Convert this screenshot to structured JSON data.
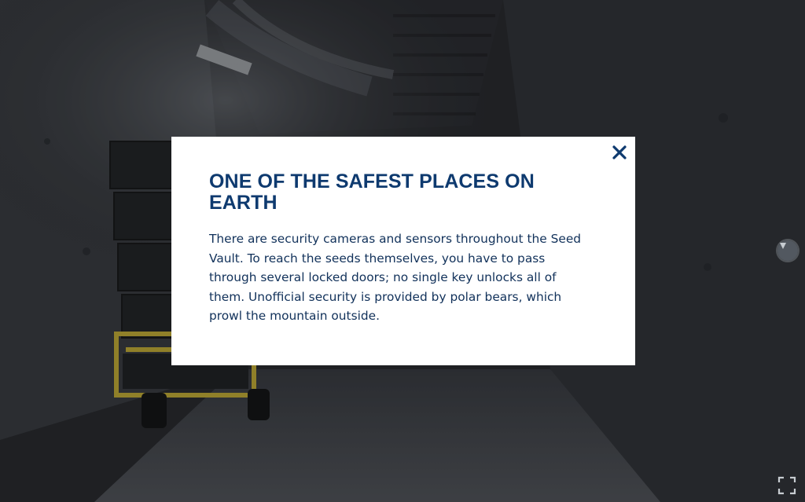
{
  "scene": {
    "hotspot_icon": "hotspot-icon",
    "fullscreen_icon": "fullscreen-icon"
  },
  "modal": {
    "title": "ONE OF THE SAFEST PLACES ON EARTH",
    "body": "There are security cameras and sensors throughout the Seed Vault. To reach the seeds themselves, you have to pass through several locked doors; no single key unlocks all of them. Unofficial security is provided by polar bears, which prowl the mountain outside.",
    "close_icon": "close-icon"
  },
  "colors": {
    "title": "#0e3a6f",
    "body_text": "#11315a",
    "modal_bg": "#ffffff",
    "cart_yellow": "#c8b23a"
  }
}
